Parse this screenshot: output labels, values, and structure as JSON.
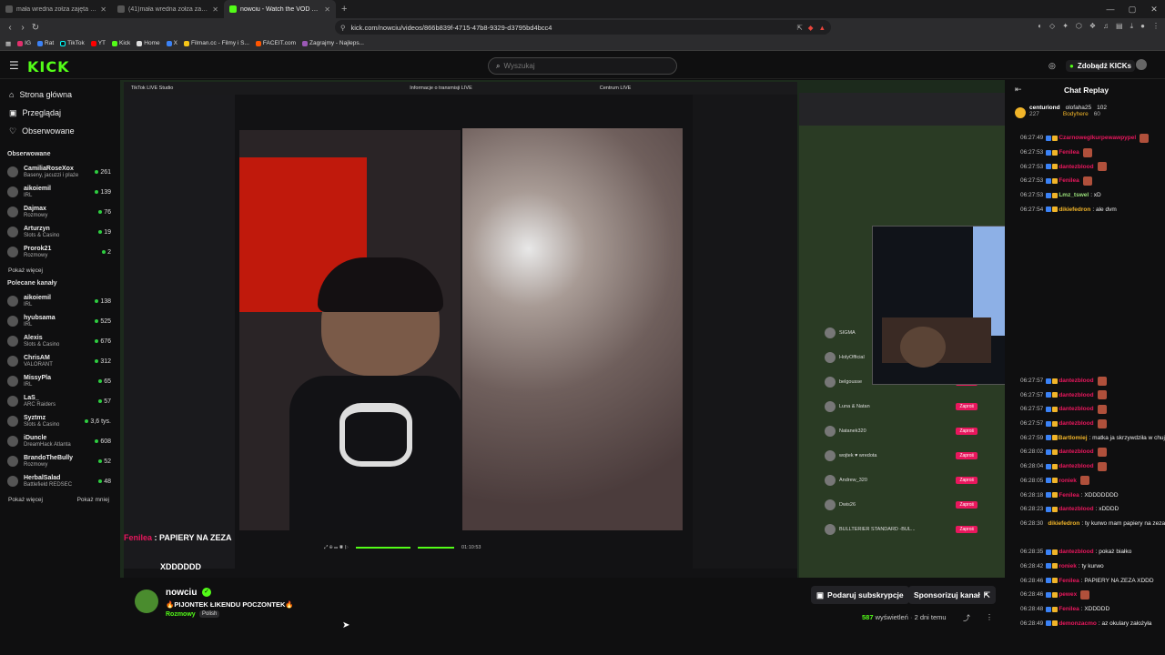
{
  "tabs": [
    {
      "title": "mała wredna zołza zajęta ♥ (@mało..."
    },
    {
      "title": "(41)mała wredna zołza zajęta ♥ (@m..."
    },
    {
      "title": "nowciu - Watch the VOD on Kick",
      "active": true
    }
  ],
  "address": {
    "url": "kick.com/nowciu/videos/866b839f-4715-47b8-9329-d3795bd4bcc4"
  },
  "bookmarks": [
    "IG",
    "Rat",
    "TikTok",
    "YT",
    "Kick",
    "Home",
    "X",
    "Filman.cc - Filmy i S...",
    "FACEIT.com",
    "Zagrajmy - Najleps..."
  ],
  "header": {
    "logo": "KICK",
    "search_placeholder": "Wyszukaj",
    "kicks_label": "Zdobądź KICKs"
  },
  "sidebar": {
    "nav": [
      "Strona główna",
      "Przeglądaj",
      "Obserwowane"
    ],
    "followed_title": "Obserwowane",
    "followed": [
      {
        "name": "CamiliaRoseXox",
        "cat": "Baseny, jacuzzi i plaże",
        "viewers": "261"
      },
      {
        "name": "aikoiemil",
        "cat": "IRL",
        "viewers": "139"
      },
      {
        "name": "Dajmax",
        "cat": "Rozmowy",
        "viewers": "76"
      },
      {
        "name": "Arturzyn",
        "cat": "Slots & Casino",
        "viewers": "19"
      },
      {
        "name": "Prorok21",
        "cat": "Rozmowy",
        "viewers": "2"
      }
    ],
    "show_more": "Pokaż więcej",
    "recommended_title": "Polecane kanały",
    "recommended": [
      {
        "name": "aikoiemil",
        "cat": "IRL",
        "viewers": "138"
      },
      {
        "name": "hyubsama",
        "cat": "IRL",
        "viewers": "525"
      },
      {
        "name": "Alexis",
        "cat": "Slots & Casino",
        "viewers": "676"
      },
      {
        "name": "ChrisAM",
        "cat": "VALORANT",
        "viewers": "312"
      },
      {
        "name": "MissyPla",
        "cat": "IRL",
        "viewers": "65"
      },
      {
        "name": "LaS_",
        "cat": "ARC Raiders",
        "viewers": "57"
      },
      {
        "name": "Syztmz",
        "cat": "Slots & Casino",
        "viewers": "3,6 tys."
      },
      {
        "name": "iDuncle",
        "cat": "DreamHack Atlanta",
        "viewers": "608"
      },
      {
        "name": "BrandoTheBully",
        "cat": "Rozmowy",
        "viewers": "52"
      },
      {
        "name": "HerbalSalad",
        "cat": "Battlefield REDSEC",
        "viewers": "48"
      }
    ],
    "show_more2": "Pokaż więcej",
    "show_less": "Pokaż mniej"
  },
  "video": {
    "studio_title": "TikTok LIVE Studio",
    "studio_center": "Informacje o transmisji LIVE",
    "centrum": "Centrum LIVE",
    "overlay_line1": "PAPIERY NA ZEZA",
    "overlay_line2": "XDDDDDD",
    "time": "01:10:53",
    "b2_row_names": [
      "SIGMA",
      "HolyOfficial",
      "belgousse",
      "Luna & Natan",
      "Natanek320",
      "wojtek ♥ wredota",
      "Andrew_320",
      "Dwis26",
      "BULLTERIER STANDARD -BUL..."
    ],
    "zapros": "Zaproś"
  },
  "stream": {
    "name": "nowciu",
    "title": "🔥PIJONTEK ŁIKENDU POCZONTEK🔥",
    "category": "Rozmowy",
    "language": "Polish",
    "sub_btn": "Podaruj subskrypcje",
    "sponsor_btn": "Sponsorizuj kanał",
    "views_num": "587",
    "views_label": "wyświetleń",
    "ago": "2 dni temu"
  },
  "chat": {
    "title": "Chat Replay",
    "pinned": [
      {
        "user": "centuriond",
        "count": "227"
      },
      {
        "user": "olofaha25",
        "count": "102"
      },
      {
        "user": "Bodyhere",
        "count": "60"
      }
    ],
    "messages": [
      {
        "t": "06:27:49",
        "u": "Czarnoweglkurpewawpypel",
        "c": "#e8175d",
        "m": "",
        "e": true
      },
      {
        "t": "06:27:53",
        "u": "Fenilea",
        "c": "#e8175d",
        "m": "",
        "e": true
      },
      {
        "t": "06:27:53",
        "u": "dantezblood",
        "c": "#e8175d",
        "m": "",
        "e": true
      },
      {
        "t": "06:27:53",
        "u": "Fenilea",
        "c": "#e8175d",
        "m": "",
        "e": true
      },
      {
        "t": "06:27:53",
        "u": "Lmz_tswel",
        "c": "#9ae07a",
        "m": ": xD"
      },
      {
        "t": "06:27:54",
        "u": "dikiefedron",
        "c": "#f0b429",
        "m": ": ale dvm"
      },
      {
        "t": "",
        "u": "",
        "c": "#fff",
        "m": ""
      },
      {
        "t": "",
        "u": "",
        "c": "#fff",
        "m": ""
      },
      {
        "t": "",
        "u": "",
        "c": "#fff",
        "m": ""
      },
      {
        "t": "",
        "u": "",
        "c": "#fff",
        "m": ""
      },
      {
        "t": "",
        "u": "",
        "c": "#fff",
        "m": ""
      },
      {
        "t": "",
        "u": "",
        "c": "#fff",
        "m": ""
      },
      {
        "t": "",
        "u": "",
        "c": "#fff",
        "m": ""
      },
      {
        "t": "",
        "u": "",
        "c": "#fff",
        "m": ""
      },
      {
        "t": "",
        "u": "",
        "c": "#fff",
        "m": ""
      },
      {
        "t": "",
        "u": "",
        "c": "#fff",
        "m": ""
      },
      {
        "t": "",
        "u": "",
        "c": "#fff",
        "m": ""
      },
      {
        "t": "06:27:57",
        "u": "dantezblood",
        "c": "#e8175d",
        "m": "",
        "e": true
      },
      {
        "t": "06:27:57",
        "u": "dantezblood",
        "c": "#e8175d",
        "m": "",
        "e": true
      },
      {
        "t": "06:27:57",
        "u": "dantezblood",
        "c": "#e8175d",
        "m": "",
        "e": true
      },
      {
        "t": "06:27:57",
        "u": "dantezblood",
        "c": "#e8175d",
        "m": "",
        "e": true
      },
      {
        "t": "06:27:59",
        "u": "Bartlomiej",
        "c": "#f0b429",
        "m": ": matka ja skrzywdziła w chuj"
      },
      {
        "t": "06:28:02",
        "u": "dantezblood",
        "c": "#e8175d",
        "m": "",
        "e": true
      },
      {
        "t": "06:28:04",
        "u": "dantezblood",
        "c": "#e8175d",
        "m": "",
        "e": true
      },
      {
        "t": "06:28:05",
        "u": "roniek",
        "c": "#e8175d",
        "m": "",
        "e": true
      },
      {
        "t": "06:28:18",
        "u": "Fenilea",
        "c": "#e8175d",
        "m": ": XDDDDDDD"
      },
      {
        "t": "06:28:23",
        "u": "dantezblood",
        "c": "#e8175d",
        "m": ": xDDDD"
      },
      {
        "t": "06:28:30",
        "u": "dikiefedron",
        "c": "#f0b429",
        "m": ": ty kurwo mam papiery na zeza XDD"
      },
      {
        "t": "",
        "u": "",
        "c": "#fff",
        "m": ""
      },
      {
        "t": "06:28:35",
        "u": "dantezblood",
        "c": "#e8175d",
        "m": ": pokaż białko"
      },
      {
        "t": "06:28:42",
        "u": "roniek",
        "c": "#e8175d",
        "m": ": ty kurwo"
      },
      {
        "t": "06:28:46",
        "u": "Fenilea",
        "c": "#e8175d",
        "m": ": PAPIERY NA ZEZA XDDD"
      },
      {
        "t": "06:28:46",
        "u": "pewex",
        "c": "#e8175d",
        "m": "",
        "e": true
      },
      {
        "t": "06:28:48",
        "u": "Fenilea",
        "c": "#e8175d",
        "m": ": XDDDDD"
      },
      {
        "t": "06:28:49",
        "u": "demonzacmo",
        "c": "#e8175d",
        "m": ": az okulary założyła"
      }
    ]
  }
}
